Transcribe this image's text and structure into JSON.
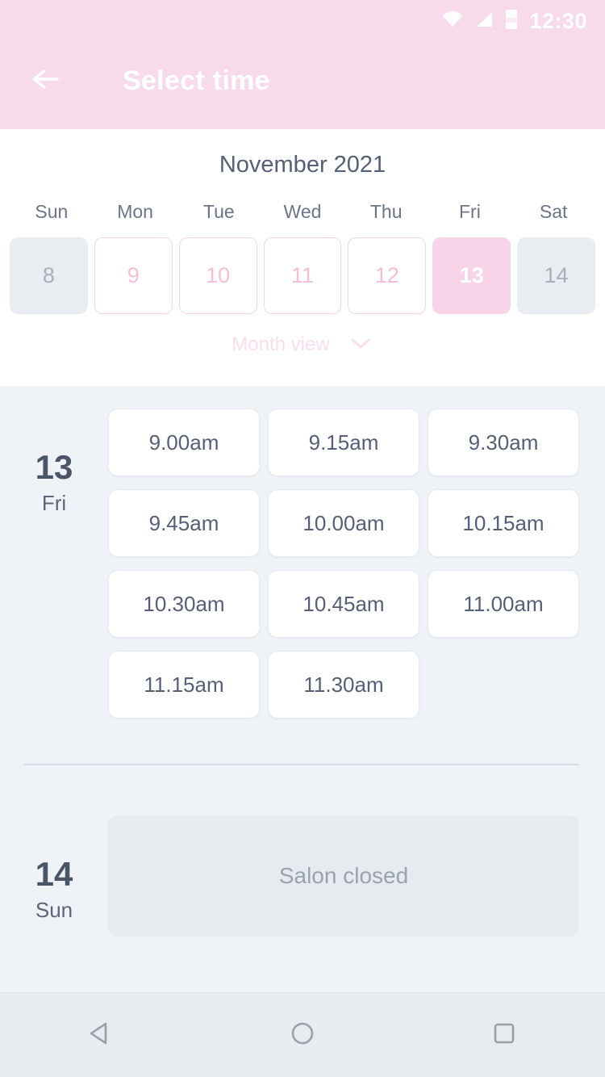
{
  "statusbar": {
    "time": "12:30",
    "wifi_icon": "wifi-icon",
    "signal_icon": "cellular-signal-icon",
    "battery_icon": "battery-icon"
  },
  "appbar": {
    "title": "Select time",
    "back_icon": "back-arrow-icon"
  },
  "calendar": {
    "month": "November 2021",
    "weekdays": [
      "Sun",
      "Mon",
      "Tue",
      "Wed",
      "Thu",
      "Fri",
      "Sat"
    ],
    "dates": [
      {
        "day": "8",
        "state": "disabled"
      },
      {
        "day": "9",
        "state": "available"
      },
      {
        "day": "10",
        "state": "available"
      },
      {
        "day": "11",
        "state": "available"
      },
      {
        "day": "12",
        "state": "available"
      },
      {
        "day": "13",
        "state": "selected"
      },
      {
        "day": "14",
        "state": "disabled"
      }
    ],
    "view_toggle_label": "Month view",
    "view_toggle_icon": "chevron-down-icon"
  },
  "days": [
    {
      "date": "13",
      "weekday": "Fri",
      "slots": [
        "9.00am",
        "9.15am",
        "9.30am",
        "9.45am",
        "10.00am",
        "10.15am",
        "10.30am",
        "10.45am",
        "11.00am",
        "11.15am",
        "11.30am"
      ]
    },
    {
      "date": "14",
      "weekday": "Sun",
      "closed_label": "Salon closed"
    }
  ],
  "navbar": {
    "back_label": "back-nav",
    "home_label": "home-nav",
    "recents_label": "recents-nav"
  },
  "colors": {
    "accent_pink": "#f7d4e7",
    "appbar_pink": "#f7dbeb",
    "text_dark": "#4a5568",
    "surface": "#eff2f6"
  }
}
